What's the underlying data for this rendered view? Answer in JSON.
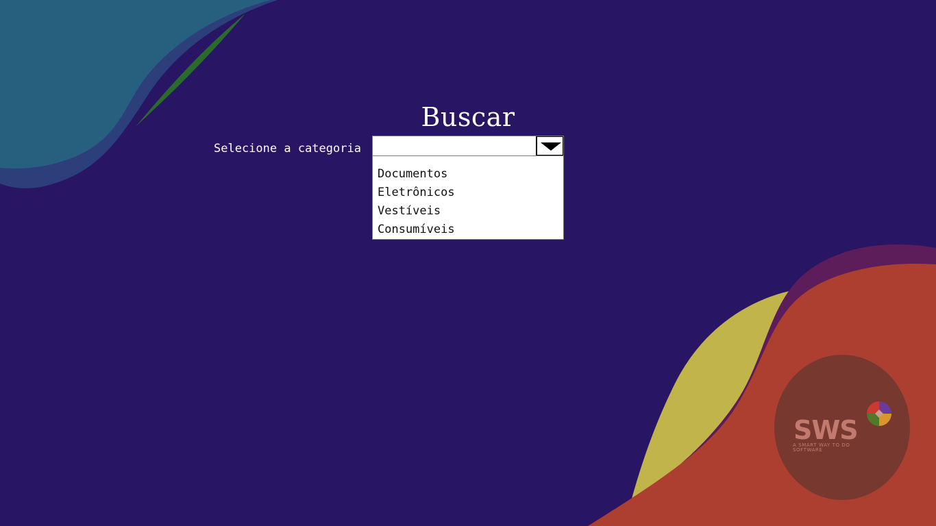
{
  "page": {
    "title": "Buscar"
  },
  "form": {
    "category_label": "Selecione a categoria",
    "category_select": {
      "selected_value": "",
      "is_open": true,
      "options": [
        "Documentos",
        "Eletrônicos",
        "Vestíveis",
        "Consumíveis"
      ]
    }
  },
  "branding": {
    "logo_text": "SWS",
    "logo_tagline": "A SMART WAY TO DO SOFTWARE",
    "logo_icon": "four-color-diamond-icon"
  },
  "colors": {
    "background": "#281564",
    "teal_shape": "#27607f",
    "green_shape": "#2a6b2b",
    "yellow_shape": "#c0b44a",
    "purple_shape": "#5c1d5a",
    "red_shape": "#ac3f30",
    "logo_circle": "#773830"
  }
}
